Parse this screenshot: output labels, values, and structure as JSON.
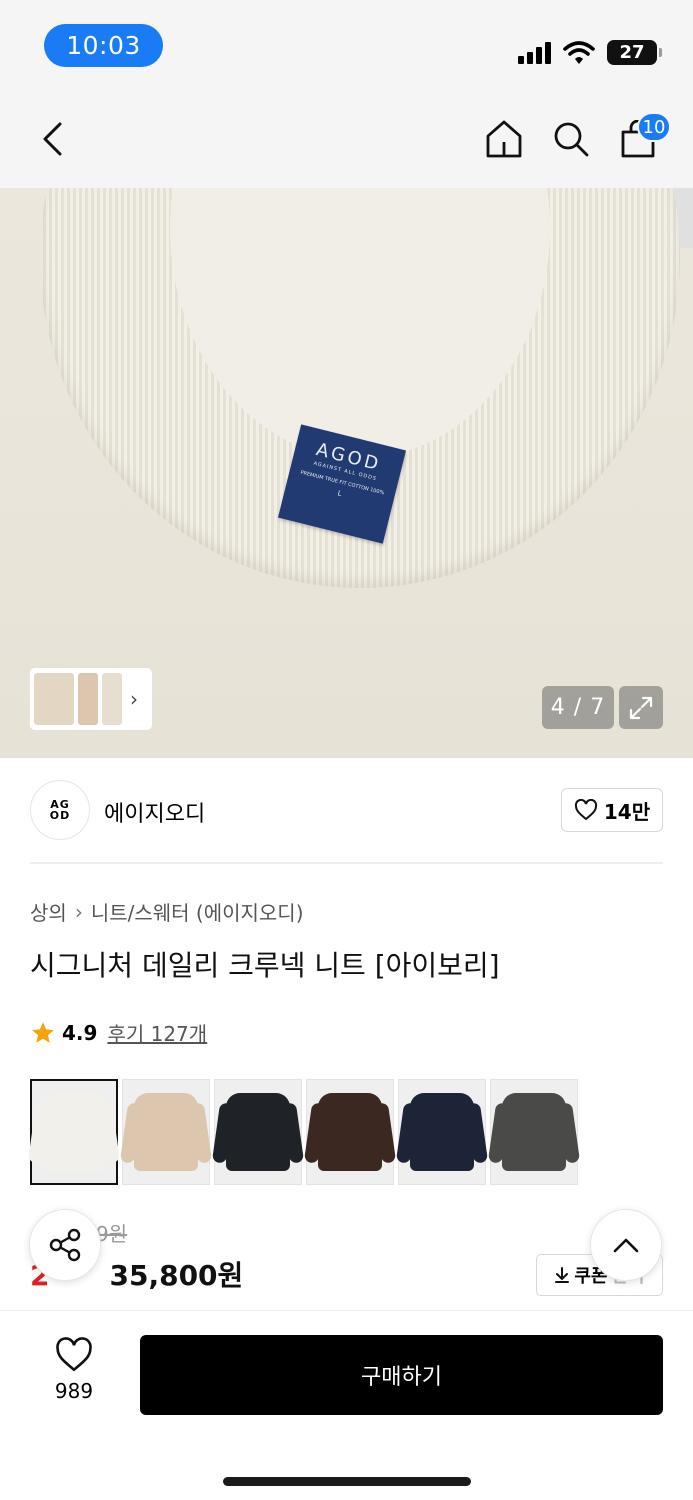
{
  "status_bar": {
    "time": "10:03",
    "battery": "27",
    "icons": [
      "signal-icon",
      "wifi-icon",
      "battery-icon"
    ]
  },
  "nav": {
    "icons": [
      "back-arrow-icon",
      "home-icon",
      "search-icon",
      "cart-icon"
    ],
    "cart_count": "10"
  },
  "hero": {
    "label_brand": "AGOD",
    "label_line2": "AGAINST ALL ODDS",
    "label_line3": "PREMIUM TRUE FIT COTTON 100%",
    "label_size": "L",
    "counter": "4 / 7",
    "icons": [
      "chevron-right-icon",
      "expand-icon"
    ]
  },
  "brand": {
    "logo_top": "AG",
    "logo_bottom": "OD",
    "name": "에이지오디",
    "likes": "14만"
  },
  "product": {
    "breadcrumb": [
      "상의",
      "니트/스웨터 (에이지오디)"
    ],
    "title": "시그니처 데일리 크루넥 니트 [아이보리]",
    "rating": "4.9",
    "reviews": "후기 127개",
    "swatch_colors": [
      "#f2f0ea",
      "#dcc6ad",
      "#1f2226",
      "#3a2821",
      "#1d2437",
      "#4a4b49"
    ],
    "selected_swatch": 0,
    "original_price_partial": "9원",
    "discount_partial": "2",
    "price": "35,800원",
    "coupon_label": "쿠폰",
    "coupon_partial_suffix": "받기"
  },
  "bottom": {
    "wish_count": "989",
    "buy_label": "구매하기"
  },
  "colors": {
    "accent": "#1a7cf5",
    "discount_red": "#e02020",
    "buy_button": "#000000"
  }
}
